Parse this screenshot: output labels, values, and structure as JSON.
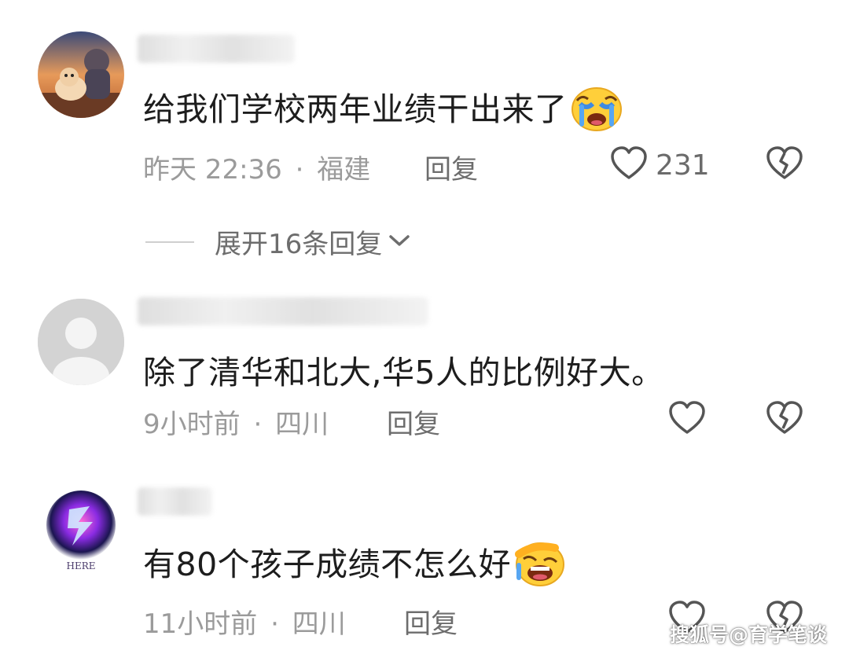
{
  "comments": [
    {
      "text": "给我们学校两年业绩干出来了",
      "emoji": "crying-face-emoji",
      "time": "昨天 22:36",
      "location": "福建",
      "reply_label": "回复",
      "like_count": "231"
    },
    {
      "text": "除了清华和北大,华5人的比例好大。",
      "time": "9小时前",
      "location": "四川",
      "reply_label": "回复",
      "like_count": ""
    },
    {
      "text": "有80个孩子成绩不怎么好",
      "emoji": "laughing-crying-face-emoji",
      "time": "11小时前",
      "location": "四川",
      "reply_label": "回复",
      "like_count": ""
    }
  ],
  "expand_replies": "展开16条回复",
  "meta_separator": "·",
  "avatar3_label": "HERE",
  "watermark": "搜狐号@育学笔谈",
  "colors": {
    "text": "#1d1d1d",
    "meta": "#9b9b9b",
    "action": "#6d6d6d",
    "emoji_face": "#ffcf3a"
  }
}
